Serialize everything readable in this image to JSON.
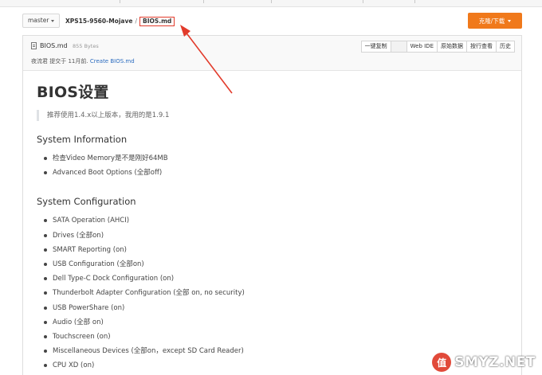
{
  "toolbar": {
    "branch": "master",
    "repo": "XPS15-9560-Mojave",
    "separator": "/",
    "file": "BIOS.md",
    "clone_label": "克隆/下载"
  },
  "file_header": {
    "name": "BIOS.md",
    "size": "855 Bytes",
    "author": "夜流君",
    "commit_text": "提交于",
    "commit_time": "11月前",
    "commit_message": "Create BIOS.md",
    "tools": [
      "一键复制",
      "",
      "Web IDE",
      "原始数据",
      "按行查看",
      "历史"
    ]
  },
  "content": {
    "title": "BIOS设置",
    "note": "推荐使用1.4.x以上版本，我用的是1.9.1",
    "section1": {
      "heading": "System Information",
      "items": [
        "检查Video Memory是不是刚好64MB",
        "Advanced Boot Options (全部off)"
      ]
    },
    "section2": {
      "heading": "System Configuration",
      "items": [
        "SATA Operation (AHCI)",
        "Drives (全部on)",
        "SMART Reporting (on)",
        "USB Configuration (全部on)",
        "Dell Type-C Dock Configuration (on)",
        "Thunderbolt Adapter Configuration (全部 on, no security)",
        "USB PowerShare (on)",
        "Audio (全部 on)",
        "Touchscreen (on)",
        "Miscellaneous Devices (全部on，except SD Card Reader)",
        "CPU XD (on)"
      ]
    }
  },
  "watermark": {
    "logo": "值",
    "text": "SMYZ.NET"
  },
  "colors": {
    "clone_button": "#f0791b",
    "annotation_red": "#e23b2b",
    "link": "#2a6bbf"
  }
}
